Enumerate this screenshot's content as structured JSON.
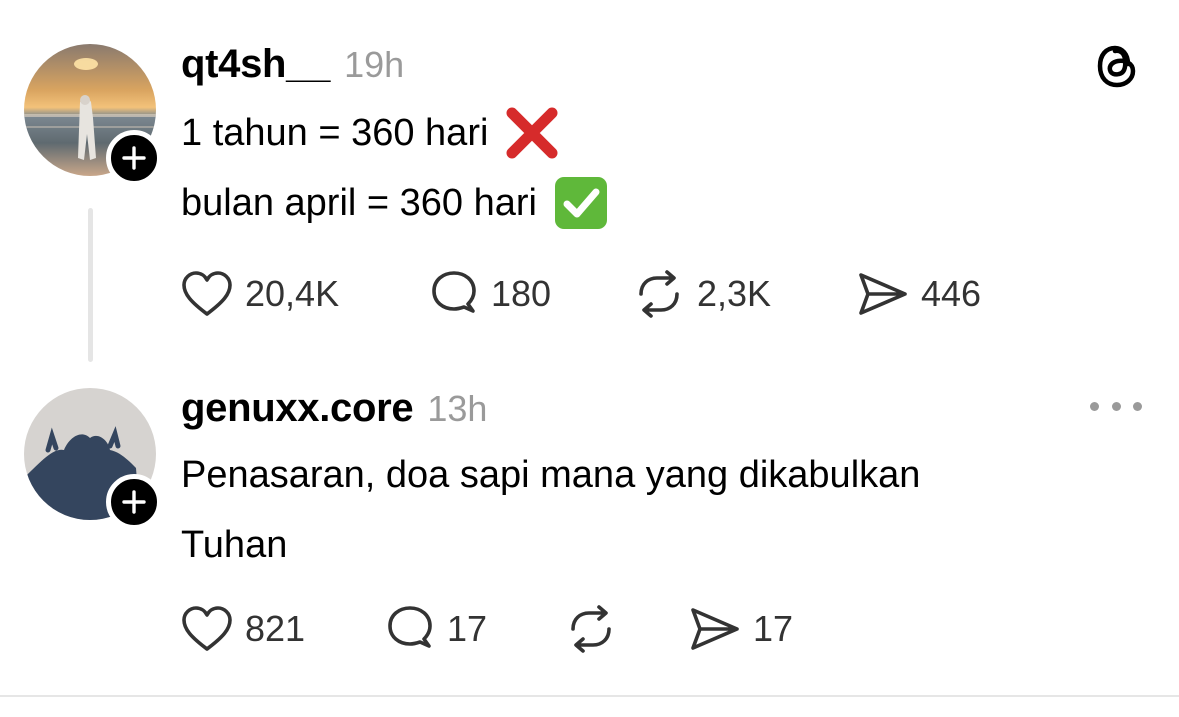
{
  "posts": [
    {
      "username": "qt4sh__",
      "timestamp": "19h",
      "lines": [
        {
          "text": "1 tahun = 360 hari",
          "emoji": "cross-mark"
        },
        {
          "text": "bulan april = 360 hari",
          "emoji": "check-mark-button"
        }
      ],
      "stats": {
        "likes": "20,4K",
        "replies": "180",
        "reposts": "2,3K",
        "shares": "446"
      }
    },
    {
      "username": "genuxx.core",
      "timestamp": "13h",
      "lines": [
        {
          "text": "Penasaran, doa sapi mana yang dikabulkan"
        },
        {
          "text": "Tuhan"
        }
      ],
      "stats": {
        "likes": "821",
        "replies": "17",
        "reposts": "",
        "shares": "17"
      }
    }
  ],
  "icons": {
    "header_right_post_1": "threads-logo-icon",
    "header_right_post_2": "more-icon",
    "actions": [
      "heart-icon",
      "comment-icon",
      "repost-icon",
      "share-icon"
    ]
  },
  "colors": {
    "text": "#000000",
    "muted": "#9a9a9a",
    "count": "#333333",
    "cross_red": "#d62b2b",
    "check_green": "#5fb83a",
    "thread_line": "#e5e5e5"
  }
}
